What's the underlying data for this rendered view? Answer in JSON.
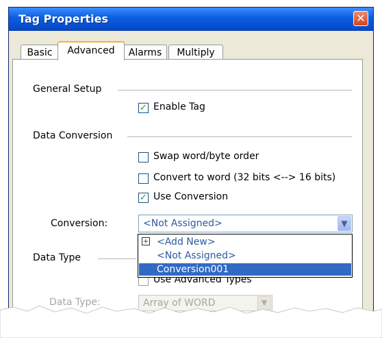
{
  "window": {
    "title": "Tag Properties"
  },
  "tabs": [
    {
      "label": "Basic"
    },
    {
      "label": "Advanced"
    },
    {
      "label": "Alarms"
    },
    {
      "label": "Multiply"
    }
  ],
  "general_setup": {
    "heading": "General Setup",
    "enable_tag": {
      "label": "Enable Tag",
      "checked": true
    }
  },
  "data_conversion": {
    "heading": "Data Conversion",
    "swap": {
      "label": "Swap word/byte order",
      "checked": false
    },
    "convert": {
      "label": "Convert to word (32 bits <--> 16 bits)",
      "checked": false
    },
    "use_conversion": {
      "label": "Use Conversion",
      "checked": true
    },
    "conversion_label": "Conversion:",
    "conversion_value": "<Not Assigned>",
    "dropdown_options": [
      "<Add New>",
      "<Not Assigned>",
      "Conversion001"
    ],
    "selected_option": "Conversion001"
  },
  "data_type_section": {
    "heading": "Data Type",
    "use_advanced_partial": "Use Advanced Types",
    "data_type_label": "Data Type:",
    "data_type_value": "Array of WORD"
  },
  "colors": {
    "titlebar": "#0a5fe0",
    "selection": "#316ac5",
    "close": "#d4441c",
    "check": "#21a121"
  }
}
